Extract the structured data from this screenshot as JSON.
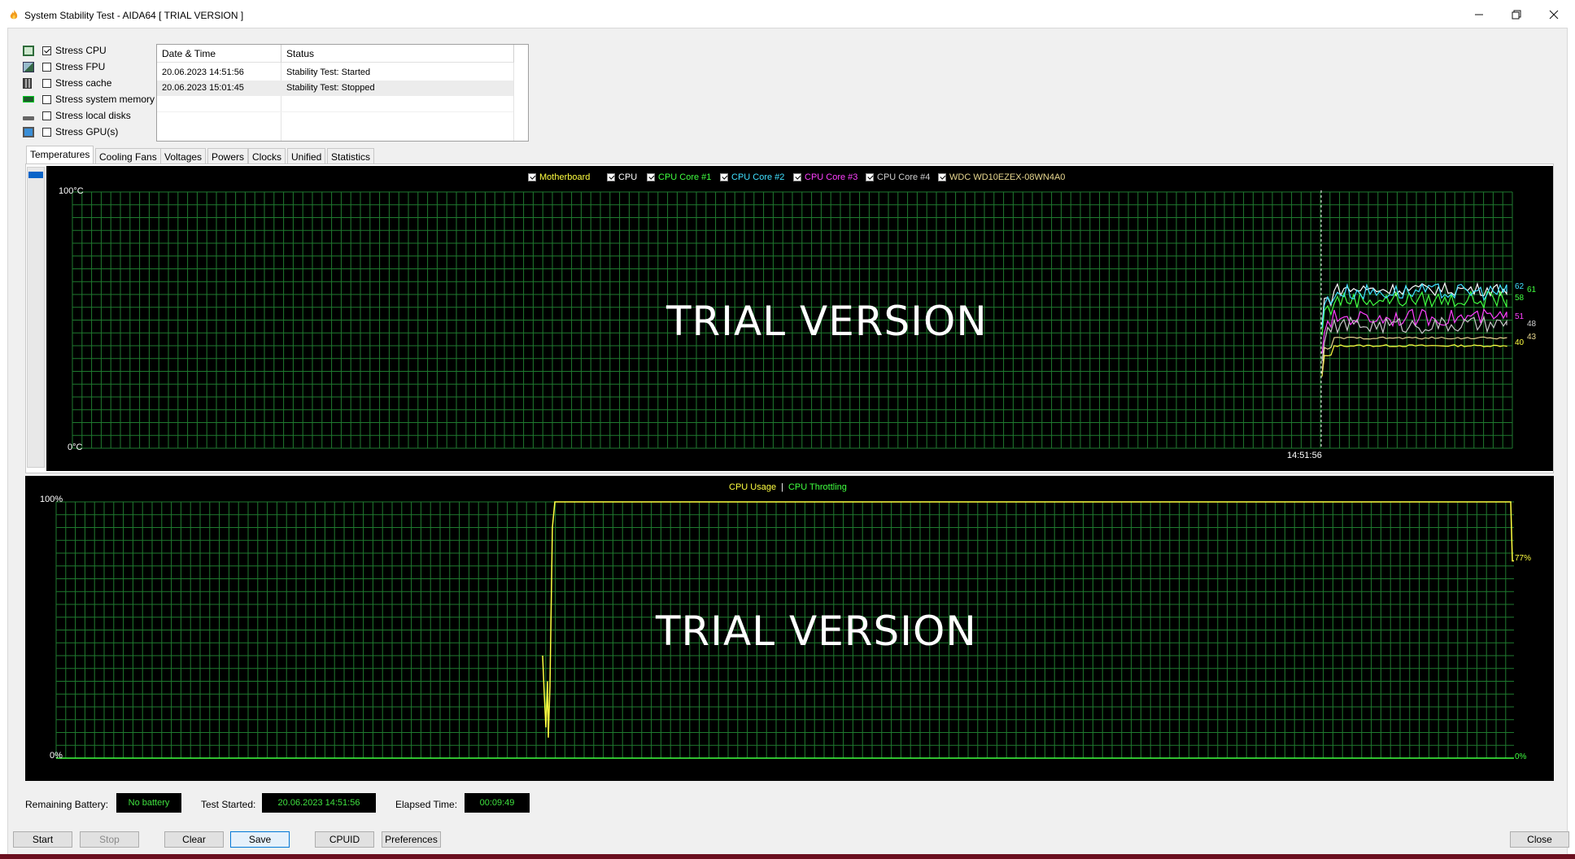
{
  "window": {
    "title": "System Stability Test - AIDA64  [ TRIAL VERSION ]",
    "controls": [
      "minimize",
      "restore",
      "close"
    ]
  },
  "stress_options": [
    {
      "label": "Stress CPU",
      "checked": true,
      "icon": "cpu-chip-icon"
    },
    {
      "label": "Stress FPU",
      "checked": false,
      "icon": "fpu-icon"
    },
    {
      "label": "Stress cache",
      "checked": false,
      "icon": "cache-icon"
    },
    {
      "label": "Stress system memory",
      "checked": false,
      "icon": "memory-icon"
    },
    {
      "label": "Stress local disks",
      "checked": false,
      "icon": "disk-icon"
    },
    {
      "label": "Stress GPU(s)",
      "checked": false,
      "icon": "monitor-icon"
    }
  ],
  "log": {
    "columns": [
      "Date & Time",
      "Status"
    ],
    "rows": [
      {
        "datetime": "20.06.2023 14:51:56",
        "status": "Stability Test: Started"
      },
      {
        "datetime": "20.06.2023 15:01:45",
        "status": "Stability Test: Stopped"
      }
    ]
  },
  "tabs": [
    "Temperatures",
    "Cooling Fans",
    "Voltages",
    "Powers",
    "Clocks",
    "Unified",
    "Statistics"
  ],
  "active_tab": "Temperatures",
  "colors": {
    "grid": "#1f7a2f",
    "motherboard": "#ffff40",
    "cpu": "#ffffff",
    "core1": "#40ff40",
    "core2": "#40e0ff",
    "core3": "#ff40ff",
    "core4": "#c8c8c8",
    "disk": "#e8d890",
    "cpu_usage": "#ffff40",
    "cpu_throttling": "#40ff40"
  },
  "temp_chart": {
    "legend": [
      "Motherboard",
      "CPU",
      "CPU Core #1",
      "CPU Core #2",
      "CPU Core #3",
      "CPU Core #4",
      "WDC WD10EZEX-08WN4A0"
    ],
    "y_max_label": "100°C",
    "y_min_label": "0°C",
    "time_label": "14:51:56",
    "watermark": "TRIAL VERSION",
    "current_values": [
      "62",
      "61",
      "58",
      "51",
      "48",
      "43",
      "40"
    ]
  },
  "usage_chart": {
    "legend_usage": "CPU Usage",
    "legend_separator": "|",
    "legend_throttling": "CPU Throttling",
    "y_max_label": "100%",
    "y_min_label": "0%",
    "watermark": "TRIAL VERSION",
    "usage_value": "77%",
    "throttling_value": "0%"
  },
  "chart_data": [
    {
      "type": "line",
      "title": "",
      "ylim": [
        0,
        100
      ],
      "yunit": "°C",
      "series": [
        {
          "name": "Motherboard",
          "final": 40
        },
        {
          "name": "CPU",
          "final": 62
        },
        {
          "name": "CPU Core #1",
          "final": 58
        },
        {
          "name": "CPU Core #2",
          "final": 61
        },
        {
          "name": "CPU Core #3",
          "final": 51
        },
        {
          "name": "CPU Core #4",
          "final": 48
        },
        {
          "name": "WDC WD10EZEX-08WN4A0",
          "final": 43
        }
      ],
      "x_marker": "14:51:56"
    },
    {
      "type": "line",
      "title": "",
      "ylim": [
        0,
        100
      ],
      "yunit": "%",
      "series": [
        {
          "name": "CPU Usage",
          "final": 77
        },
        {
          "name": "CPU Throttling",
          "final": 0
        }
      ]
    }
  ],
  "status": {
    "battery_label": "Remaining Battery:",
    "battery_value": "No battery",
    "started_label": "Test Started:",
    "started_value": "20.06.2023 14:51:56",
    "elapsed_label": "Elapsed Time:",
    "elapsed_value": "00:09:49"
  },
  "buttons": {
    "start": "Start",
    "stop": "Stop",
    "clear": "Clear",
    "save": "Save",
    "cpuid": "CPUID",
    "preferences": "Preferences",
    "close": "Close"
  }
}
